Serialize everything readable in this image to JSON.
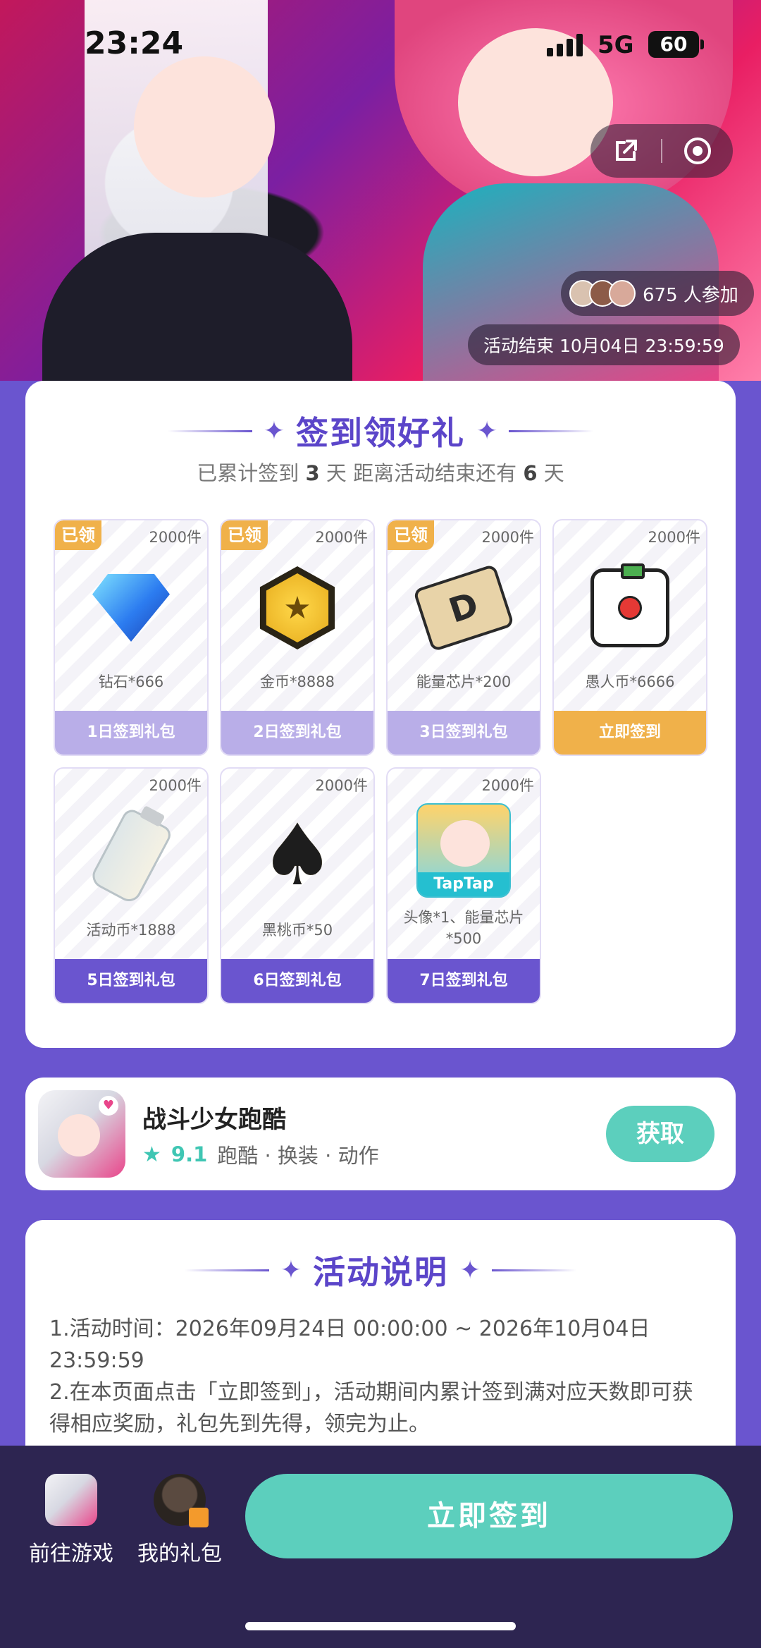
{
  "status_bar": {
    "time": "23:24",
    "network": "5G",
    "battery": "60"
  },
  "hero": {
    "participants_text": "675 人参加",
    "end_time": "活动结束 10月04日 23:59:59"
  },
  "signin": {
    "title": "签到领好礼",
    "progress_prefix": "已累计签到 ",
    "progress_days": "3",
    "progress_mid": " 天  距离活动结束还有 ",
    "progress_remaining": "6",
    "progress_suffix": " 天",
    "claimed_label": "已领",
    "gifts": [
      {
        "stock": "2000件",
        "name": "钻石*666",
        "button": "1日签到礼包",
        "icon": "diamond-icon",
        "state": "claimed"
      },
      {
        "stock": "2000件",
        "name": "金币*8888",
        "button": "2日签到礼包",
        "icon": "gold-coin-icon",
        "state": "claimed"
      },
      {
        "stock": "2000件",
        "name": "能量芯片*200",
        "button": "3日签到礼包",
        "icon": "energy-chip-icon",
        "state": "claimed"
      },
      {
        "stock": "2000件",
        "name": "愚人币*6666",
        "button": "立即签到",
        "icon": "fool-coin-icon",
        "state": "active"
      },
      {
        "stock": "2000件",
        "name": "活动币*1888",
        "button": "5日签到礼包",
        "icon": "milk-bottle-icon",
        "state": "pending"
      },
      {
        "stock": "2000件",
        "name": "黑桃币*50",
        "button": "6日签到礼包",
        "icon": "spade-coin-icon",
        "state": "pending"
      },
      {
        "stock": "2000件",
        "name": "头像*1、能量芯片*500",
        "button": "7日签到礼包",
        "icon": "taptap-avatar-icon",
        "state": "pending"
      }
    ]
  },
  "app": {
    "name": "战斗少女跑酷",
    "score": "9.1",
    "tags": "跑酷 · 换装 · 动作",
    "get_label": "获取"
  },
  "rules": {
    "title": "活动说明",
    "line1": "1.活动时间：2026年09月24日 00:00:00 ~ 2026年10月04日 23:59:59",
    "line2": "2.在本页面点击「立即签到」，活动期间内累计签到满对应天数即可获得相应奖励，礼包先到先得，领完为止。"
  },
  "bottom_bar": {
    "game_label": "前往游戏",
    "gift_label": "我的礼包",
    "signin_label": "立即签到"
  },
  "colors": {
    "brand_purple": "#6a55cf",
    "accent_teal": "#5ccfbd",
    "claimed_orange": "#f0b14a"
  }
}
